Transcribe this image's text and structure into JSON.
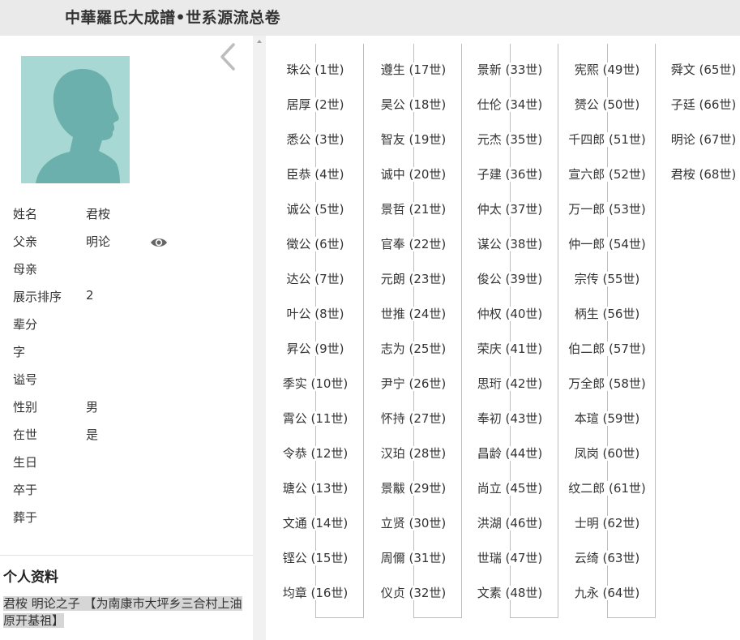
{
  "header": {
    "title": "中華羅氏大成譜•世系源流总卷"
  },
  "profile": {
    "rows": [
      {
        "label": "姓名",
        "value": "君桉"
      },
      {
        "label": "父亲",
        "value": "明论"
      },
      {
        "label": "母亲",
        "value": ""
      },
      {
        "label": "展示排序",
        "value": "2"
      },
      {
        "label": "辈分",
        "value": ""
      },
      {
        "label": "字",
        "value": ""
      },
      {
        "label": "谥号",
        "value": ""
      },
      {
        "label": "性别",
        "value": "男"
      },
      {
        "label": "在世",
        "value": "是"
      },
      {
        "label": "生日",
        "value": ""
      },
      {
        "label": "卒于",
        "value": ""
      },
      {
        "label": "葬于",
        "value": ""
      }
    ],
    "section_title": "个人资料",
    "bio": "君桉 明论之子 【为南康市大坪乡三合村上油原开基祖】"
  },
  "lineage": {
    "columns": [
      [
        "珠公 (1世)",
        "居厚 (2世)",
        "悉公 (3世)",
        "臣恭 (4世)",
        "诚公 (5世)",
        "徵公 (6世)",
        "达公 (7世)",
        "叶公 (8世)",
        "昇公 (9世)",
        "季实 (10世)",
        "霄公 (11世)",
        "令恭 (12世)",
        "瑭公 (13世)",
        "文通 (14世)",
        "铿公 (15世)",
        "均章 (16世)"
      ],
      [
        "遵生 (17世)",
        "昊公 (18世)",
        "智友 (19世)",
        "诚中 (20世)",
        "景哲 (21世)",
        "官奉 (22世)",
        "元朗 (23世)",
        "世推 (24世)",
        "志为 (25世)",
        "尹宁 (26世)",
        "怀持 (27世)",
        "汉珀 (28世)",
        "景黻 (29世)",
        "立贤 (30世)",
        "周儞 (31世)",
        "仪贞 (32世)"
      ],
      [
        "景新 (33世)",
        "仕伦 (34世)",
        "元杰 (35世)",
        "子建 (36世)",
        "仲太 (37世)",
        "谋公 (38世)",
        "俊公 (39世)",
        "仲权 (40世)",
        "荣庆 (41世)",
        "思珩 (42世)",
        "奉初 (43世)",
        "昌龄 (44世)",
        "尚立 (45世)",
        "洪湖 (46世)",
        "世瑞 (47世)",
        "文素 (48世)"
      ],
      [
        "宪熙 (49世)",
        "赟公 (50世)",
        "千四郎 (51世)",
        "宣六郎 (52世)",
        "万一郎 (53世)",
        "仲一郎 (54世)",
        "宗传 (55世)",
        "柄生 (56世)",
        "伯二郎 (57世)",
        "万全郎 (58世)",
        "本瑄 (59世)",
        "凤岗 (60世)",
        "纹二郎 (61世)",
        "士明 (62世)",
        "云绮 (63世)",
        "九永 (64世)"
      ],
      [
        "舜文 (65世)",
        "子廷 (66世)",
        "明论 (67世)",
        "君桉 (68世)"
      ]
    ]
  },
  "colors": {
    "header_bg": "#eaeaea",
    "avatar_bg": "#a8d8d4",
    "avatar_silhouette": "#6bb0ac"
  }
}
